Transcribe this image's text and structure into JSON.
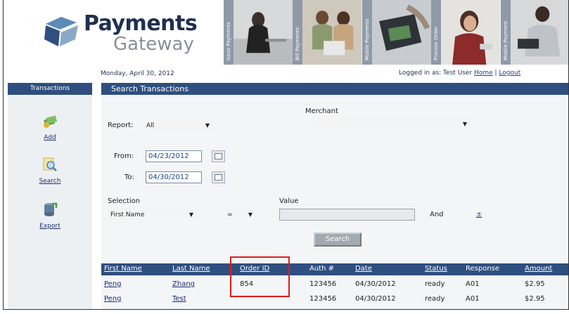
{
  "brand": {
    "title": "Payments",
    "subtitle": "Gateway"
  },
  "banner": {
    "tabs": [
      "Issue Payments",
      "Bill Payments",
      "Mobile Payments",
      "Process Order",
      "Mobile Payment"
    ]
  },
  "header": {
    "date": "Monday, April 30, 2012",
    "login_prefix": "Logged in as: Test User",
    "home_link": "Home",
    "separator": "|",
    "logout_link": "Logout"
  },
  "sidebar": {
    "title": "Transactions",
    "items": [
      {
        "label": "Add",
        "icon": "add-transaction-icon"
      },
      {
        "label": "Search",
        "icon": "search-icon"
      },
      {
        "label": "Export",
        "icon": "export-icon"
      }
    ]
  },
  "main": {
    "title": "Search Transactions",
    "report_label": "Report:",
    "report_value": "All",
    "merchant_label": "Merchant",
    "merchant_value": "",
    "from_label": "From:",
    "from_value": "04/23/2012",
    "to_label": "To:",
    "to_value": "04/30/2012",
    "selection_label": "Selection",
    "selection_value": "First Name",
    "operator_value": "=",
    "value_label": "Value",
    "value_value": "",
    "and_label": "And",
    "plus_minus": "±",
    "search_button": "Search"
  },
  "table": {
    "headers": [
      "First Name",
      "Last Name",
      "Order ID",
      "Auth #",
      "Date",
      "Status",
      "Response",
      "Amount"
    ],
    "rows": [
      [
        "Peng",
        "Zhang",
        "854",
        "123456",
        "04/30/2012",
        "ready",
        "A01",
        "$2.95"
      ],
      [
        "Peng",
        "Test",
        "",
        "123456",
        "04/30/2012",
        "ready",
        "A01",
        "$2.95"
      ]
    ]
  },
  "colors": {
    "header_bar": "#2e4f7f",
    "highlight": "#e01b1b",
    "link": "#1f2f6f"
  }
}
